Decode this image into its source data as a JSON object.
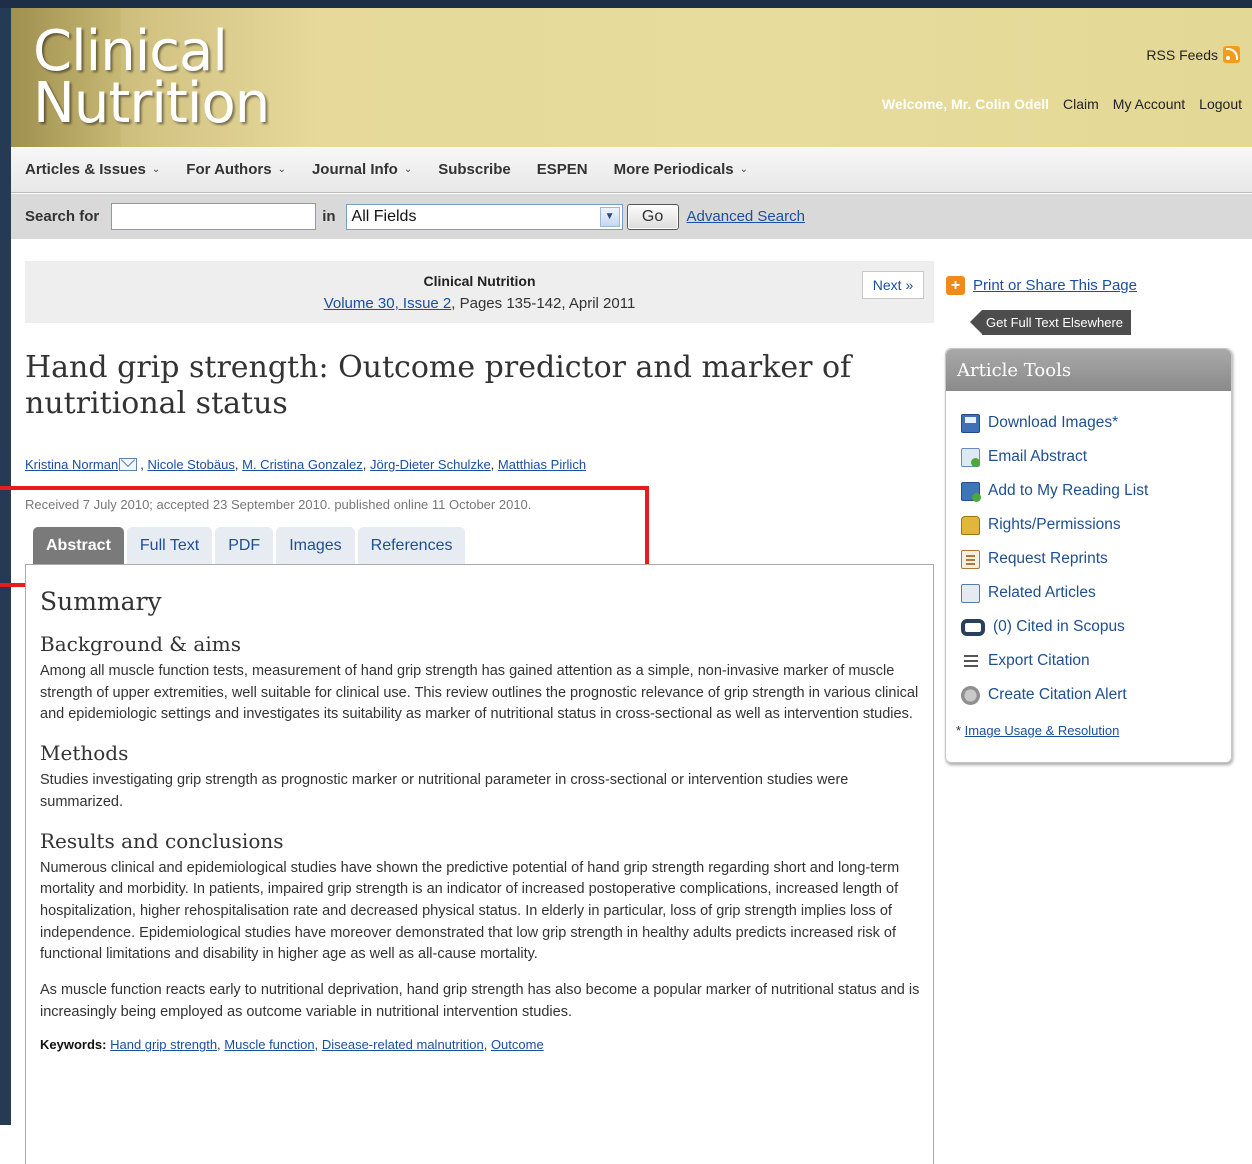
{
  "header": {
    "logo_line1": "Clinical",
    "logo_line2": "Nutrition",
    "rss_label": "RSS Feeds",
    "welcome": "Welcome, Mr. Colin Odell",
    "links": [
      "Claim",
      "My Account",
      "Logout"
    ]
  },
  "nav": {
    "items": [
      {
        "label": "Articles & Issues",
        "dropdown": true
      },
      {
        "label": "For Authors",
        "dropdown": true
      },
      {
        "label": "Journal Info",
        "dropdown": true
      },
      {
        "label": "Subscribe",
        "dropdown": false
      },
      {
        "label": "ESPEN",
        "dropdown": false
      },
      {
        "label": "More Periodicals",
        "dropdown": true
      }
    ]
  },
  "search": {
    "label": "Search for",
    "value": "",
    "in_label": "in",
    "field_selected": "All Fields",
    "go_label": "Go",
    "advanced_label": "Advanced Search"
  },
  "issue": {
    "journal": "Clinical Nutrition",
    "volume_link": "Volume 30, Issue 2",
    "pages_date": ", Pages 135-142, April 2011",
    "next_label": "Next »"
  },
  "article": {
    "title": "Hand grip strength: Outcome predictor and marker of nutritional status",
    "authors": [
      "Kristina Norman",
      "Nicole Stobäus",
      "M. Cristina Gonzalez",
      "Jörg-Dieter Schulzke",
      "Matthias Pirlich"
    ],
    "dates": "Received 7 July 2010; accepted 23 September 2010. published online 11 October 2010."
  },
  "tabs": [
    {
      "label": "Abstract",
      "active": true
    },
    {
      "label": "Full Text",
      "active": false
    },
    {
      "label": "PDF",
      "active": false
    },
    {
      "label": "Images",
      "active": false
    },
    {
      "label": "References",
      "active": false
    }
  ],
  "abstract": {
    "summary_heading": "Summary",
    "background_heading": "Background & aims",
    "background_text": "Among all muscle function tests, measurement of hand grip strength has gained attention as a simple, non-invasive marker of muscle strength of upper extremities, well suitable for clinical use. This review outlines the prognostic relevance of grip strength in various clinical and epidemiologic settings and investigates its suitability as marker of nutritional status in cross-sectional as well as intervention studies.",
    "methods_heading": "Methods",
    "methods_text": "Studies investigating grip strength as prognostic marker or nutritional parameter in cross-sectional or intervention studies were summarized.",
    "results_heading": "Results and conclusions",
    "results_text1": "Numerous clinical and epidemiological studies have shown the predictive potential of hand grip strength regarding short and long-term mortality and morbidity. In patients, impaired grip strength is an indicator of increased postoperative complications, increased length of hospitalization, higher rehospitalisation rate and decreased physical status. In elderly in particular, loss of grip strength implies loss of independence. Epidemiological studies have moreover demonstrated that low grip strength in healthy adults predicts increased risk of functional limitations and disability in higher age as well as all-cause mortality.",
    "results_text2": "As muscle function reacts early to nutritional deprivation, hand grip strength has also become a popular marker of nutritional status and is increasingly being employed as outcome variable in nutritional intervention studies.",
    "keywords_label": "Keywords:",
    "keywords": [
      "Hand grip strength",
      "Muscle function",
      "Disease-related malnutrition",
      "Outcome"
    ]
  },
  "sidebar": {
    "print_share": "Print or Share This Page",
    "get_full_text": "Get Full Text Elsewhere",
    "tools_title": "Article Tools",
    "tools": [
      {
        "label": "Download Images*",
        "icon": "download-icon"
      },
      {
        "label": "Email Abstract",
        "icon": "email-icon"
      },
      {
        "label": "Add to My Reading List",
        "icon": "reading-list-icon"
      },
      {
        "label": "Rights/Permissions",
        "icon": "lock-icon"
      },
      {
        "label": "Request Reprints",
        "icon": "reprints-icon"
      },
      {
        "label": "Related Articles",
        "icon": "related-articles-icon"
      },
      {
        "label": "(0) Cited in Scopus",
        "icon": "scopus-icon"
      },
      {
        "label": "Export Citation",
        "icon": "export-icon"
      },
      {
        "label": "Create Citation Alert",
        "icon": "alert-gear-icon"
      }
    ],
    "note_prefix": "* ",
    "note_link": "Image Usage & Resolution"
  },
  "colors": {
    "accent_link": "#1a4fa0",
    "highlight_box": "#e81c1c",
    "header_gold": "#e6d99a"
  }
}
